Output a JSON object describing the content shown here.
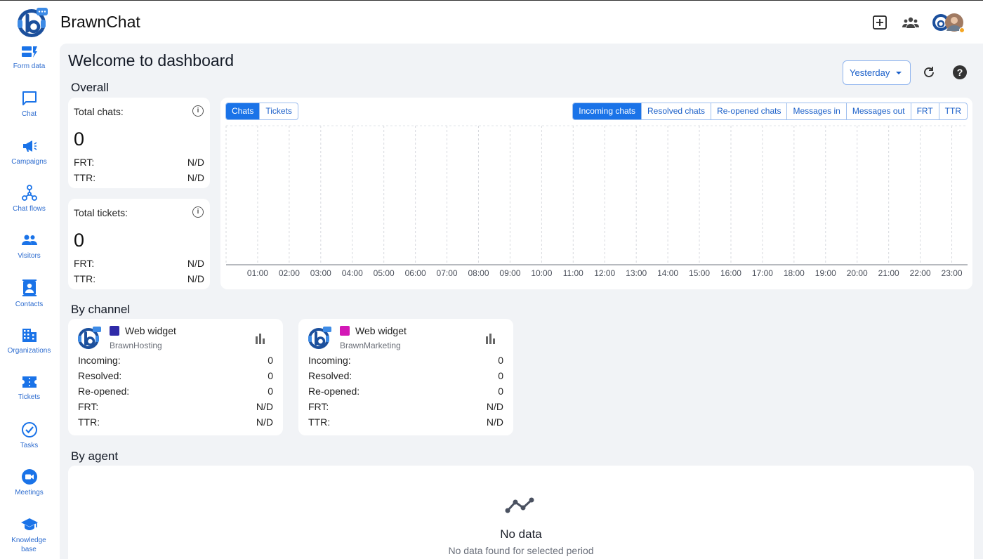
{
  "app": {
    "title": "BrawnChat"
  },
  "sidebar": {
    "items": [
      {
        "label": "Form data",
        "icon": "form-data-icon"
      },
      {
        "label": "Chat",
        "icon": "chat-icon"
      },
      {
        "label": "Campaigns",
        "icon": "megaphone-icon"
      },
      {
        "label": "Chat flows",
        "icon": "flow-icon"
      },
      {
        "label": "Visitors",
        "icon": "people-icon"
      },
      {
        "label": "Contacts",
        "icon": "contact-card-icon"
      },
      {
        "label": "Organizations",
        "icon": "building-icon"
      },
      {
        "label": "Tickets",
        "icon": "ticket-icon"
      },
      {
        "label": "Tasks",
        "icon": "check-circle-icon"
      },
      {
        "label": "Meetings",
        "icon": "video-icon"
      },
      {
        "label": "Knowledge base",
        "icon": "graduation-cap-icon"
      }
    ]
  },
  "main": {
    "title": "Welcome to dashboard",
    "period": "Yesterday",
    "overall": {
      "heading": "Overall",
      "chats": {
        "title": "Total chats:",
        "value": "0",
        "frt_label": "FRT:",
        "frt": "N/D",
        "ttr_label": "TTR:",
        "ttr": "N/D"
      },
      "tickets": {
        "title": "Total tickets:",
        "value": "0",
        "frt_label": "FRT:",
        "frt": "N/D",
        "ttr_label": "TTR:",
        "ttr": "N/D"
      }
    },
    "chart_tabs": {
      "left": [
        "Chats",
        "Tickets"
      ],
      "left_active": 0,
      "right": [
        "Incoming chats",
        "Resolved chats",
        "Re-opened chats",
        "Messages in",
        "Messages out",
        "FRT",
        "TTR"
      ],
      "right_active": 0
    },
    "by_channel": {
      "heading": "By channel",
      "channels": [
        {
          "name": "Web widget",
          "sub": "BrawnHosting",
          "color": "#2f2aa8",
          "incoming": "0",
          "resolved": "0",
          "reopened": "0",
          "frt": "N/D",
          "ttr": "N/D"
        },
        {
          "name": "Web widget",
          "sub": "BrawnMarketing",
          "color": "#d318b6",
          "incoming": "0",
          "resolved": "0",
          "reopened": "0",
          "frt": "N/D",
          "ttr": "N/D"
        }
      ],
      "labels": {
        "incoming": "Incoming:",
        "resolved": "Resolved:",
        "reopened": "Re-opened:",
        "frt": "FRT:",
        "ttr": "TTR:"
      }
    },
    "by_agent": {
      "heading": "By agent",
      "empty_title": "No data",
      "empty_sub": "No data found for selected period"
    }
  },
  "chart_data": {
    "type": "line",
    "title": "",
    "xlabel": "",
    "ylabel": "",
    "x": [
      "01:00",
      "02:00",
      "03:00",
      "04:00",
      "05:00",
      "06:00",
      "07:00",
      "08:00",
      "09:00",
      "10:00",
      "11:00",
      "12:00",
      "13:00",
      "14:00",
      "15:00",
      "16:00",
      "17:00",
      "18:00",
      "19:00",
      "20:00",
      "21:00",
      "22:00",
      "23:00"
    ],
    "series": [],
    "grid": true
  }
}
